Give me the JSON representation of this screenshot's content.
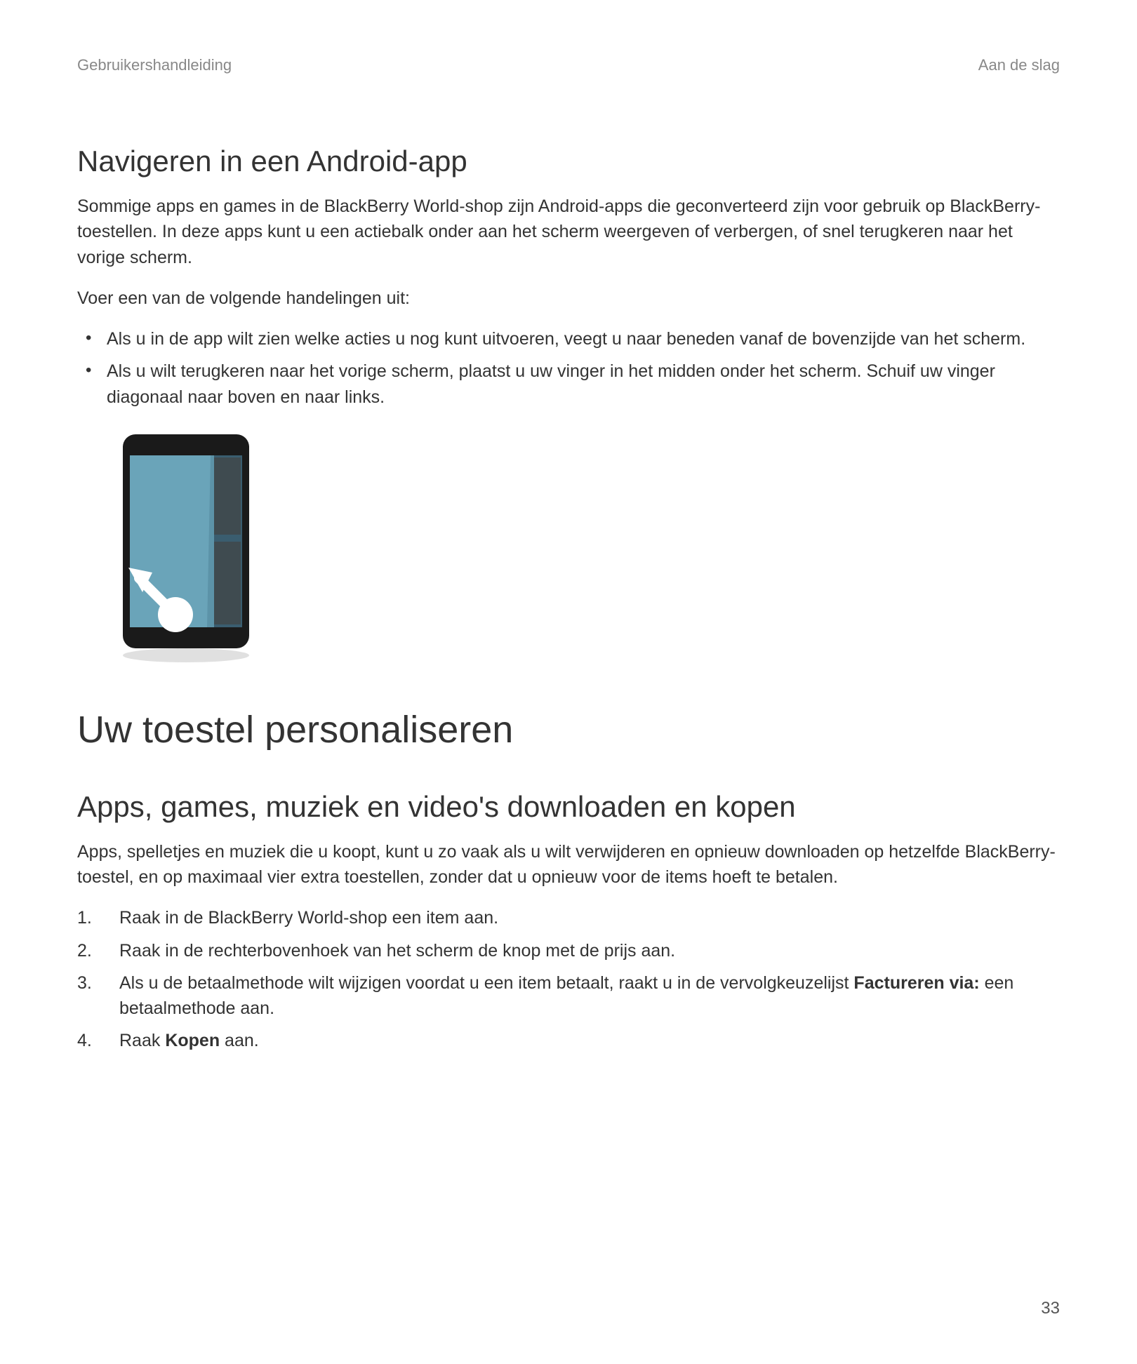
{
  "header": {
    "left": "Gebruikershandleiding",
    "right": "Aan de slag"
  },
  "section1": {
    "heading": "Navigeren in een Android-app",
    "para1": "Sommige apps en games in de BlackBerry World-shop zijn Android-apps die geconverteerd zijn voor gebruik op BlackBerry-toestellen. In deze apps kunt u een actiebalk onder aan het scherm weergeven of verbergen, of snel terugkeren naar het vorige scherm.",
    "para2": "Voer een van de volgende handelingen uit:",
    "bullets": [
      "Als u in de app wilt zien welke acties u nog kunt uitvoeren, veegt u naar beneden vanaf de bovenzijde van het scherm.",
      "Als u wilt terugkeren naar het vorige scherm, plaatst u uw vinger in het midden onder het scherm. Schuif uw vinger diagonaal naar boven en naar links."
    ]
  },
  "section2": {
    "heading": "Uw toestel personaliseren"
  },
  "section3": {
    "heading": "Apps, games, muziek en video's downloaden en kopen",
    "para1": "Apps, spelletjes en muziek die u koopt, kunt u zo vaak als u wilt verwijderen en opnieuw downloaden op hetzelfde BlackBerry-toestel, en op maximaal vier extra toestellen, zonder dat u opnieuw voor de items hoeft te betalen.",
    "steps": {
      "s1": "Raak in de BlackBerry World-shop een item aan.",
      "s2": "Raak in de rechterbovenhoek van het scherm de knop met de prijs aan.",
      "s3_pre": "Als u de betaalmethode wilt wijzigen voordat u een item betaalt, raakt u in de vervolgkeuzelijst ",
      "s3_bold": "Factureren via:",
      "s3_post": " een betaalmethode aan.",
      "s4_pre": "Raak ",
      "s4_bold": "Kopen",
      "s4_post": " aan."
    }
  },
  "pageNumber": "33"
}
